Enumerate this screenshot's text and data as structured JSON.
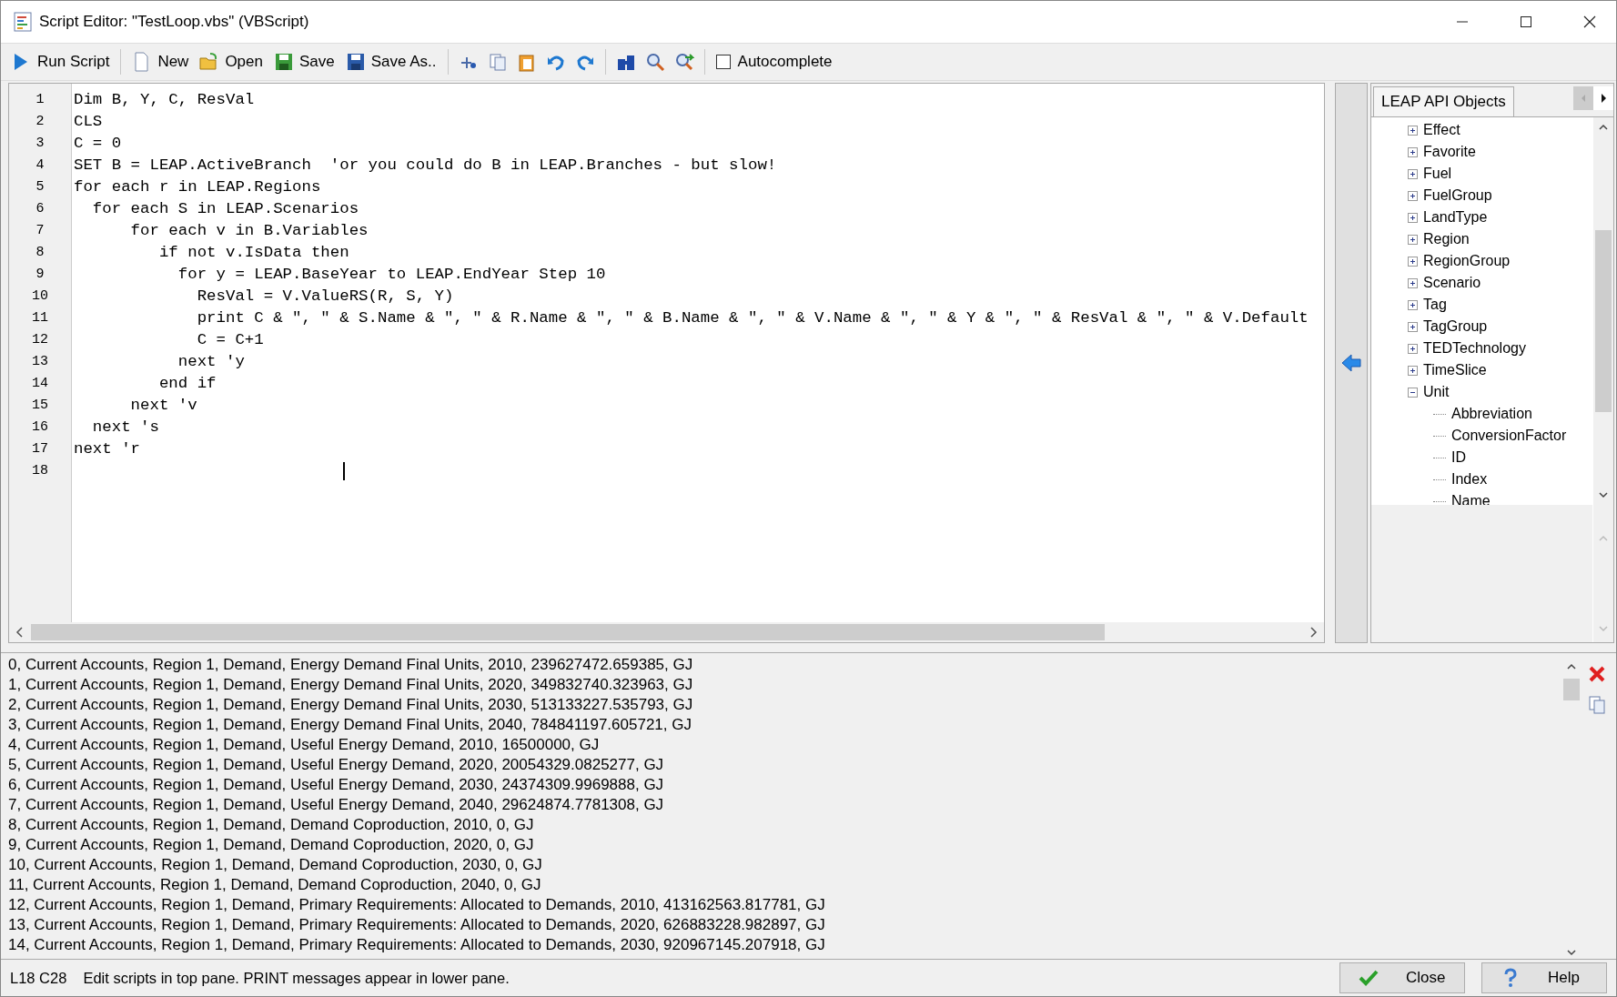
{
  "window": {
    "title": "Script Editor: \"TestLoop.vbs\" (VBScript)"
  },
  "toolbar": {
    "buttons": [
      {
        "kind": "run",
        "label": "Run Script"
      },
      {
        "kind": "new",
        "label": "New"
      },
      {
        "kind": "open",
        "label": "Open"
      },
      {
        "kind": "save",
        "label": "Save"
      },
      {
        "kind": "saveas",
        "label": "Save As.."
      }
    ],
    "autocomplete": {
      "label": "Autocomplete",
      "checked": false
    }
  },
  "editor": {
    "lines": [
      {
        "number": "1",
        "code": "Dim B, Y, C, ResVal"
      },
      {
        "number": "2",
        "code": "CLS"
      },
      {
        "number": "3",
        "code": "C = 0"
      },
      {
        "number": "4",
        "code": "SET B = LEAP.ActiveBranch  'or you could do B in LEAP.Branches - but slow!"
      },
      {
        "number": "5",
        "code": "for each r in LEAP.Regions"
      },
      {
        "number": "6",
        "code": "  for each S in LEAP.Scenarios"
      },
      {
        "number": "7",
        "code": "      for each v in B.Variables"
      },
      {
        "number": "8",
        "code": "         if not v.IsData then"
      },
      {
        "number": "9",
        "code": "           for y = LEAP.BaseYear to LEAP.EndYear Step 10"
      },
      {
        "number": "10",
        "code": "             ResVal = V.ValueRS(R, S, Y)"
      },
      {
        "number": "11",
        "code": "             print C & \", \" & S.Name & \", \" & R.Name & \", \" & B.Name & \", \" & V.Name & \", \" & Y & \", \" & ResVal & \", \" & V.Default"
      },
      {
        "number": "12",
        "code": "             C = C+1"
      },
      {
        "number": "13",
        "code": "           next 'y"
      },
      {
        "number": "14",
        "code": "         end if"
      },
      {
        "number": "15",
        "code": "      next 'v"
      },
      {
        "number": "16",
        "code": "  next 's"
      },
      {
        "number": "17",
        "code": "next 'r"
      },
      {
        "number": "18"
      }
    ]
  },
  "api_panel": {
    "tab": "LEAP API Objects",
    "tree": [
      {
        "label": "Effect",
        "expanded": false
      },
      {
        "label": "Favorite",
        "expanded": false
      },
      {
        "label": "Fuel",
        "expanded": false
      },
      {
        "label": "FuelGroup",
        "expanded": false
      },
      {
        "label": "LandType",
        "expanded": false
      },
      {
        "label": "Region",
        "expanded": false
      },
      {
        "label": "RegionGroup",
        "expanded": false
      },
      {
        "label": "Scenario",
        "expanded": false
      },
      {
        "label": "Tag",
        "expanded": false
      },
      {
        "label": "TagGroup",
        "expanded": false
      },
      {
        "label": "TEDTechnology",
        "expanded": false
      },
      {
        "label": "TimeSlice",
        "expanded": false
      },
      {
        "label": "Unit",
        "expanded": true,
        "children": [
          {
            "label": "Abbreviation"
          },
          {
            "label": "ConversionFactor"
          },
          {
            "label": "ID"
          },
          {
            "label": "Index"
          },
          {
            "label": "Name"
          }
        ]
      }
    ]
  },
  "output": {
    "lines": [
      "0, Current Accounts, Region 1, Demand, Energy Demand Final Units, 2010, 239627472.659385, GJ",
      "1, Current Accounts, Region 1, Demand, Energy Demand Final Units, 2020, 349832740.323963, GJ",
      "2, Current Accounts, Region 1, Demand, Energy Demand Final Units, 2030, 513133227.535793, GJ",
      "3, Current Accounts, Region 1, Demand, Energy Demand Final Units, 2040, 784841197.605721, GJ",
      "4, Current Accounts, Region 1, Demand, Useful Energy Demand, 2010, 16500000, GJ",
      "5, Current Accounts, Region 1, Demand, Useful Energy Demand, 2020, 20054329.0825277, GJ",
      "6, Current Accounts, Region 1, Demand, Useful Energy Demand, 2030, 24374309.9969888, GJ",
      "7, Current Accounts, Region 1, Demand, Useful Energy Demand, 2040, 29624874.7781308, GJ",
      "8, Current Accounts, Region 1, Demand, Demand Coproduction, 2010, 0, GJ",
      "9, Current Accounts, Region 1, Demand, Demand Coproduction, 2020, 0, GJ",
      "10, Current Accounts, Region 1, Demand, Demand Coproduction, 2030, 0, GJ",
      "11, Current Accounts, Region 1, Demand, Demand Coproduction, 2040, 0, GJ",
      "12, Current Accounts, Region 1, Demand, Primary Requirements: Allocated to Demands, 2010, 413162563.817781, GJ",
      "13, Current Accounts, Region 1, Demand, Primary Requirements: Allocated to Demands, 2020, 626883228.982897, GJ",
      "14, Current Accounts, Region 1, Demand, Primary Requirements: Allocated to Demands, 2030, 920967145.207918, GJ"
    ]
  },
  "status_bar": {
    "position": "L18 C28",
    "message": "Edit scripts in top pane. PRINT messages appear in lower pane.",
    "buttons": [
      {
        "kind": "close",
        "label": "Close"
      },
      {
        "kind": "help",
        "label": "Help"
      }
    ]
  }
}
